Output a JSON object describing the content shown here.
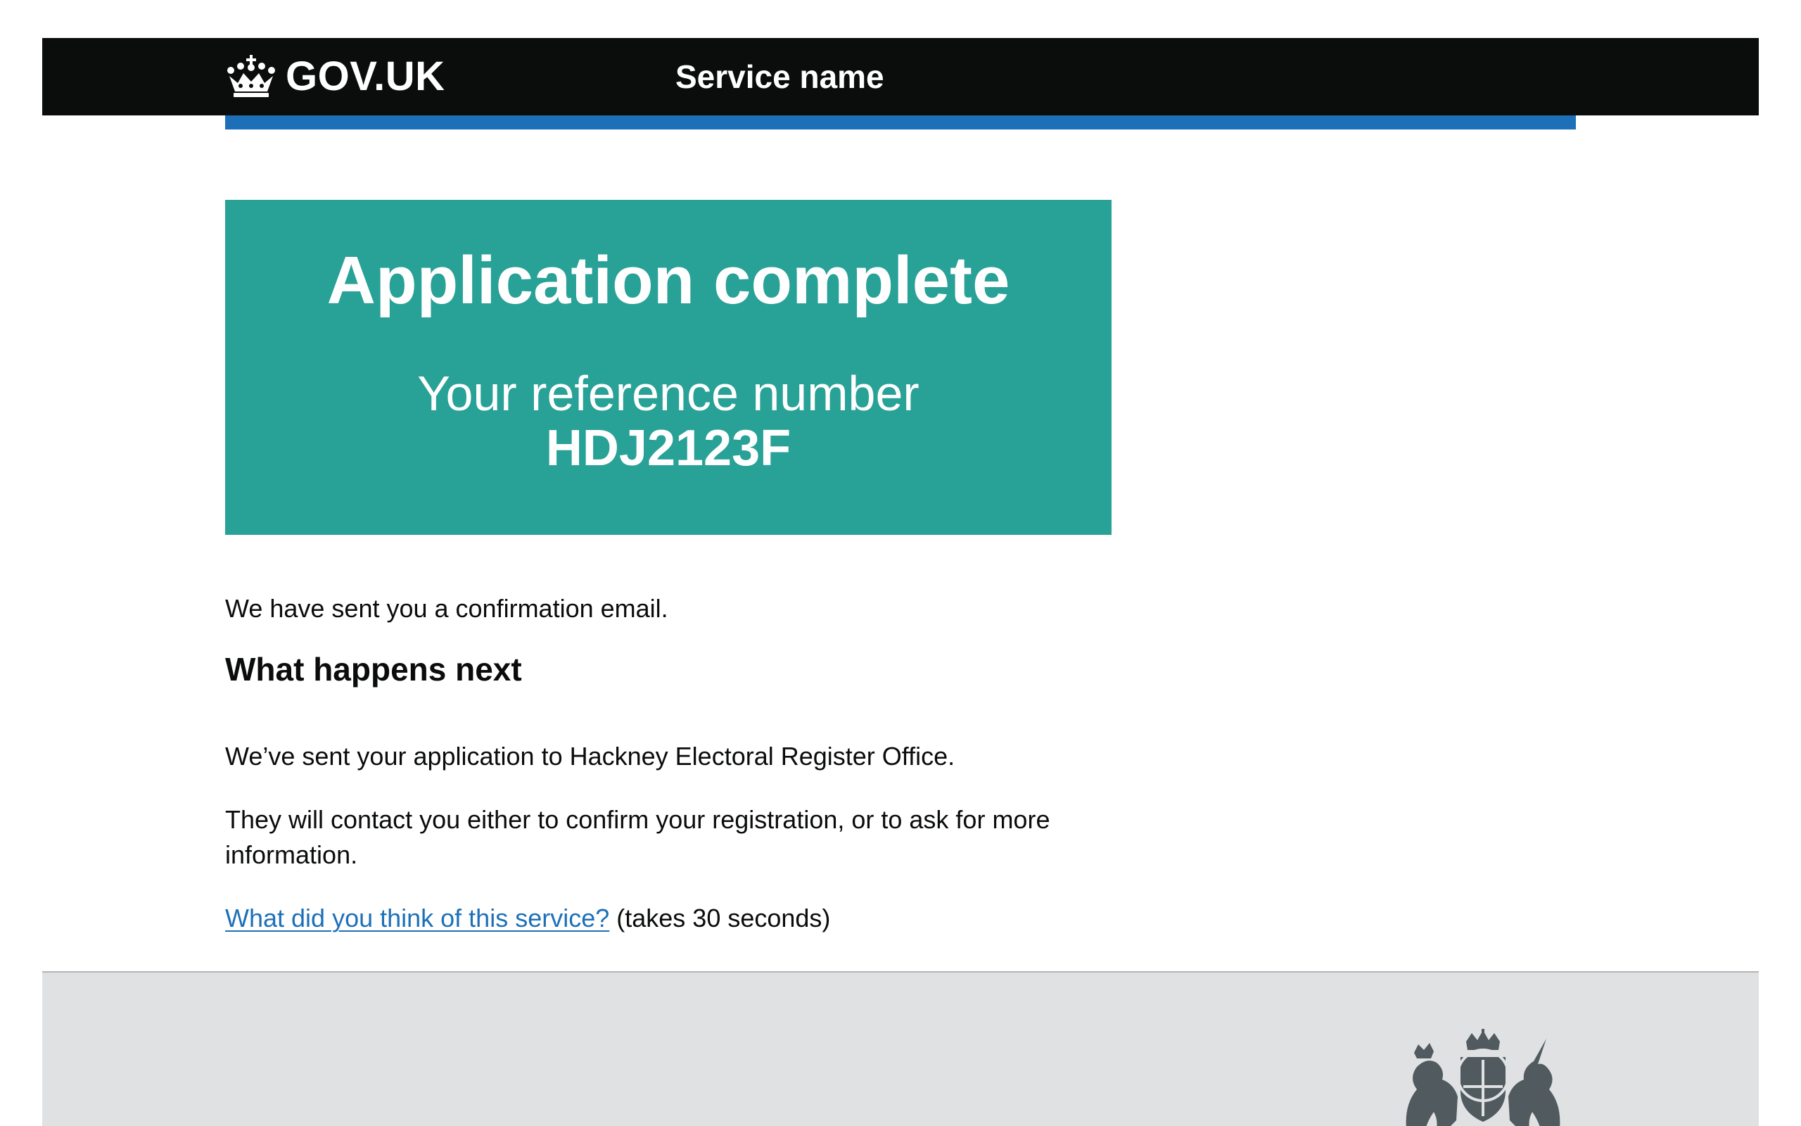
{
  "header": {
    "logo_text": "GOV.UK",
    "service_name": "Service name"
  },
  "panel": {
    "title": "Application complete",
    "reference_label": "Your reference number",
    "reference_number": "HDJ2123F"
  },
  "main": {
    "confirmation_email": "We have sent you a confirmation email.",
    "next_heading": "What happens next",
    "sent_paragraph": "We’ve sent your application to Hackney Electoral Register Office.",
    "contact_paragraph": "They will contact you either to confirm your registration, or to ask for more information.",
    "feedback_link": "What did you think of this service?",
    "feedback_suffix": " (takes 30 seconds)"
  },
  "colors": {
    "header_bg": "#0b0c0c",
    "brand_blue": "#1d70b8",
    "panel_green": "#28a197",
    "footer_bg": "#dfe1e3",
    "link": "#1d70b8"
  },
  "icons": {
    "logo": "crown-icon",
    "footer": "royal-coat-of-arms-icon"
  }
}
